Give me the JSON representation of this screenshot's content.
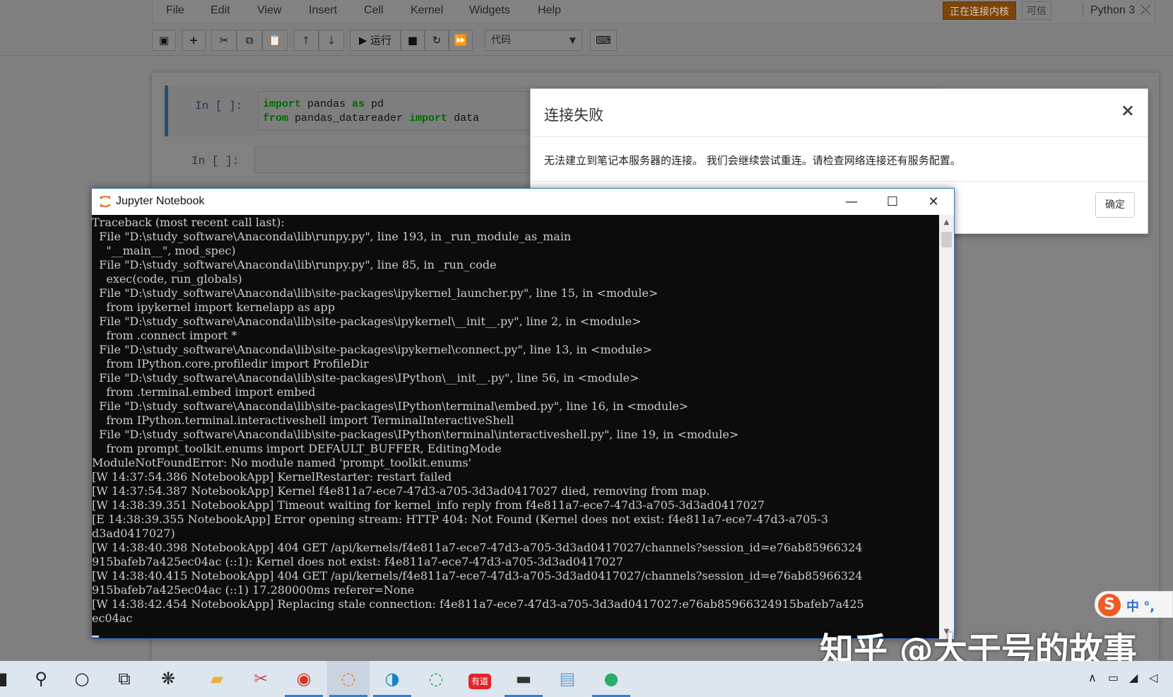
{
  "menu": {
    "items": [
      "File",
      "Edit",
      "View",
      "Insert",
      "Cell",
      "Kernel",
      "Widgets",
      "Help"
    ],
    "kernel_status": "正在连接内核",
    "trusted": "可信",
    "kernel_name": "Python 3"
  },
  "toolbar": {
    "run_label": "运行",
    "cell_type": "代码",
    "icons": [
      "save-icon",
      "plus-icon",
      "cut-icon",
      "copy-icon",
      "paste-icon",
      "arrow-up-icon",
      "arrow-down-icon",
      "run-icon",
      "stop-icon",
      "restart-icon",
      "fast-forward-icon",
      "keyboard-icon"
    ]
  },
  "cells": [
    {
      "prompt": "In  [ ]:",
      "lines": [
        [
          {
            "t": "import",
            "k": true
          },
          {
            "t": " pandas ",
            "k": false
          },
          {
            "t": "as",
            "k": true
          },
          {
            "t": " pd",
            "k": false
          }
        ],
        [
          {
            "t": "from",
            "k": true
          },
          {
            "t": " pandas_datareader ",
            "k": false
          },
          {
            "t": "import",
            "k": true
          },
          {
            "t": " data",
            "k": false
          }
        ]
      ]
    },
    {
      "prompt": "In  [ ]:",
      "lines": []
    }
  ],
  "modal": {
    "title": "连接失败",
    "body": "无法建立到笔记本服务器的连接。 我们会继续尝试重连。请检查网络连接还有服务配置。",
    "ok": "确定",
    "close": "×"
  },
  "console": {
    "title": "Jupyter Notebook",
    "lines": [
      "Traceback (most recent call last):",
      "  File \"D:\\study_software\\Anaconda\\lib\\runpy.py\", line 193, in _run_module_as_main",
      "    \"__main__\", mod_spec)",
      "  File \"D:\\study_software\\Anaconda\\lib\\runpy.py\", line 85, in _run_code",
      "    exec(code, run_globals)",
      "  File \"D:\\study_software\\Anaconda\\lib\\site-packages\\ipykernel_launcher.py\", line 15, in <module>",
      "    from ipykernel import kernelapp as app",
      "  File \"D:\\study_software\\Anaconda\\lib\\site-packages\\ipykernel\\__init__.py\", line 2, in <module>",
      "    from .connect import *",
      "  File \"D:\\study_software\\Anaconda\\lib\\site-packages\\ipykernel\\connect.py\", line 13, in <module>",
      "    from IPython.core.profiledir import ProfileDir",
      "  File \"D:\\study_software\\Anaconda\\lib\\site-packages\\IPython\\__init__.py\", line 56, in <module>",
      "    from .terminal.embed import embed",
      "  File \"D:\\study_software\\Anaconda\\lib\\site-packages\\IPython\\terminal\\embed.py\", line 16, in <module>",
      "    from IPython.terminal.interactiveshell import TerminalInteractiveShell",
      "  File \"D:\\study_software\\Anaconda\\lib\\site-packages\\IPython\\terminal\\interactiveshell.py\", line 19, in <module>",
      "    from prompt_toolkit.enums import DEFAULT_BUFFER, EditingMode",
      "ModuleNotFoundError: No module named 'prompt_toolkit.enums'",
      "[W 14:37:54.386 NotebookApp] KernelRestarter: restart failed",
      "[W 14:37:54.387 NotebookApp] Kernel f4e811a7-ece7-47d3-a705-3d3ad0417027 died, removing from map.",
      "[W 14:38:39.351 NotebookApp] Timeout waiting for kernel_info reply from f4e811a7-ece7-47d3-a705-3d3ad0417027",
      "[E 14:38:39.355 NotebookApp] Error opening stream: HTTP 404: Not Found (Kernel does not exist: f4e811a7-ece7-47d3-a705-3",
      "d3ad0417027)",
      "[W 14:38:40.398 NotebookApp] 404 GET /api/kernels/f4e811a7-ece7-47d3-a705-3d3ad0417027/channels?session_id=e76ab85966324",
      "915bafeb7a425ec04ac (::1): Kernel does not exist: f4e811a7-ece7-47d3-a705-3d3ad0417027",
      "[W 14:38:40.415 NotebookApp] 404 GET /api/kernels/f4e811a7-ece7-47d3-a705-3d3ad0417027/channels?session_id=e76ab85966324",
      "915bafeb7a425ec04ac (::1) 17.280000ms referer=None",
      "[W 14:38:42.454 NotebookApp] Replacing stale connection: f4e811a7-ece7-47d3-a705-3d3ad0417027:e76ab85966324915bafeb7a425",
      "ec04ac"
    ]
  },
  "ime": {
    "text": "中 °,"
  },
  "watermark": "知乎 @大于号的故事",
  "taskbar": {
    "apps": [
      "start-icon",
      "search-icon",
      "cortana-icon",
      "task-view-icon",
      "app-icon",
      "file-explorer-icon",
      "snipping-icon",
      "chrome-icon",
      "jupyter-icon",
      "edge-icon",
      "refresh-app-icon",
      "youdao-icon",
      "terminal-icon",
      "notepad-icon",
      "wechat-icon"
    ],
    "youdao_label": "有道"
  },
  "colors": {
    "kernel_status_bg": "#7c430a",
    "console_bg": "#0c0c0c",
    "console_text": "#cccccc",
    "taskbar_bg": "#dde6ef",
    "taskbar_active": "#2f7fd4"
  }
}
